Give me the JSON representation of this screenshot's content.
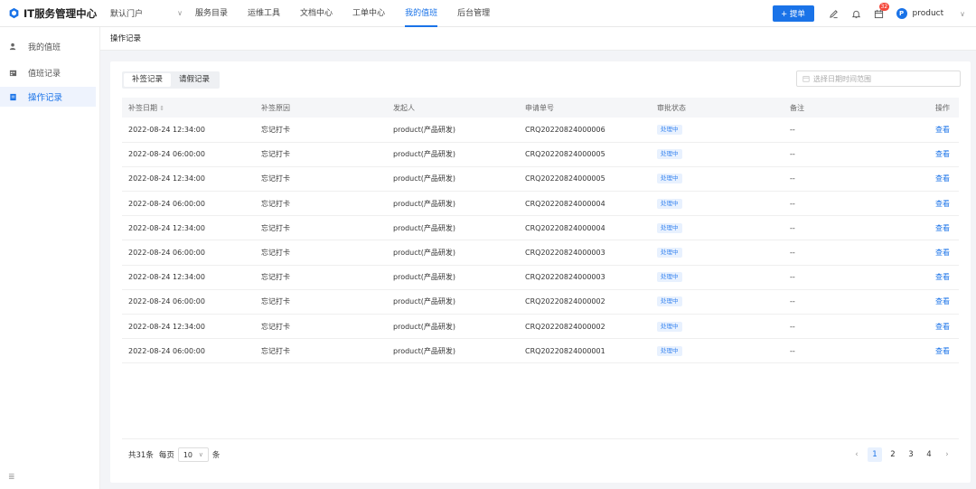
{
  "app": {
    "title": "IT服务管理中心",
    "portal": "默认门户"
  },
  "nav": [
    {
      "label": "服务目录",
      "active": false
    },
    {
      "label": "运维工具",
      "active": false
    },
    {
      "label": "文档中心",
      "active": false
    },
    {
      "label": "工单中心",
      "active": false
    },
    {
      "label": "我的值班",
      "active": true
    },
    {
      "label": "后台管理",
      "active": false
    }
  ],
  "topright": {
    "submit_label": "+ 提单",
    "notification_count": "32",
    "avatar_letter": "P",
    "username": "product"
  },
  "sidebar": [
    {
      "label": "我的值班",
      "icon": "person-icon",
      "active": false
    },
    {
      "label": "值班记录",
      "icon": "calendar-icon",
      "active": false
    },
    {
      "label": "操作记录",
      "icon": "document-icon",
      "active": true
    }
  ],
  "breadcrumb": "操作记录",
  "tabs": [
    {
      "label": "补签记录",
      "active": true
    },
    {
      "label": "请假记录",
      "active": false
    }
  ],
  "date_picker": {
    "placeholder": "选择日期时间范围"
  },
  "table": {
    "headers": [
      "补签日期",
      "补签原因",
      "发起人",
      "申请单号",
      "审批状态",
      "备注",
      "操作"
    ],
    "rows": [
      [
        "2022-08-24 12:34:00",
        "忘记打卡",
        "product(产品研发)",
        "CRQ20220824000006",
        "处理中",
        "--",
        "查看"
      ],
      [
        "2022-08-24 06:00:00",
        "忘记打卡",
        "product(产品研发)",
        "CRQ20220824000005",
        "处理中",
        "--",
        "查看"
      ],
      [
        "2022-08-24 12:34:00",
        "忘记打卡",
        "product(产品研发)",
        "CRQ20220824000005",
        "处理中",
        "--",
        "查看"
      ],
      [
        "2022-08-24 06:00:00",
        "忘记打卡",
        "product(产品研发)",
        "CRQ20220824000004",
        "处理中",
        "--",
        "查看"
      ],
      [
        "2022-08-24 12:34:00",
        "忘记打卡",
        "product(产品研发)",
        "CRQ20220824000004",
        "处理中",
        "--",
        "查看"
      ],
      [
        "2022-08-24 06:00:00",
        "忘记打卡",
        "product(产品研发)",
        "CRQ20220824000003",
        "处理中",
        "--",
        "查看"
      ],
      [
        "2022-08-24 12:34:00",
        "忘记打卡",
        "product(产品研发)",
        "CRQ20220824000003",
        "处理中",
        "--",
        "查看"
      ],
      [
        "2022-08-24 06:00:00",
        "忘记打卡",
        "product(产品研发)",
        "CRQ20220824000002",
        "处理中",
        "--",
        "查看"
      ],
      [
        "2022-08-24 12:34:00",
        "忘记打卡",
        "product(产品研发)",
        "CRQ20220824000002",
        "处理中",
        "--",
        "查看"
      ],
      [
        "2022-08-24 06:00:00",
        "忘记打卡",
        "product(产品研发)",
        "CRQ20220824000001",
        "处理中",
        "--",
        "查看"
      ]
    ]
  },
  "footer": {
    "total": "共31条",
    "per_page_label": "每页",
    "page_size": "10",
    "unit": "条"
  },
  "pagination": {
    "pages": [
      "1",
      "2",
      "3",
      "4"
    ],
    "current": "1",
    "prev": "‹",
    "next": "›"
  },
  "colors": {
    "primary": "#1a73e8",
    "badge": "#f5483b",
    "status_bg": "#e8f1fe"
  }
}
